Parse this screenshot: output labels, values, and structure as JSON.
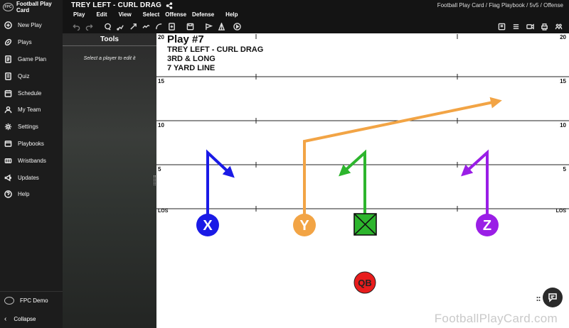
{
  "app": {
    "brand": "Football Play Card",
    "play_title": "TREY LEFT - CURL DRAG"
  },
  "breadcrumbs": "Football Play Card  /  Flag Playbook  /  5v5  /  Offense",
  "menu": [
    "Play",
    "Edit",
    "View",
    "Select",
    "Offense",
    "Defense",
    "Help"
  ],
  "sidebar": {
    "items": [
      {
        "label": "New Play",
        "icon": "plus-circle-icon"
      },
      {
        "label": "Plays",
        "icon": "football-icon"
      },
      {
        "label": "Game Plan",
        "icon": "document-icon"
      },
      {
        "label": "Quiz",
        "icon": "quiz-icon"
      },
      {
        "label": "Schedule",
        "icon": "calendar-icon"
      },
      {
        "label": "My Team",
        "icon": "user-icon"
      },
      {
        "label": "Settings",
        "icon": "gear-icon"
      },
      {
        "label": "Playbooks",
        "icon": "book-icon"
      },
      {
        "label": "Wristbands",
        "icon": "wristband-icon"
      },
      {
        "label": "Updates",
        "icon": "megaphone-icon"
      },
      {
        "label": "Help",
        "icon": "help-icon"
      }
    ],
    "user": "FPC Demo",
    "collapse": "Collapse"
  },
  "tools": {
    "title": "Tools",
    "hint": "Select a player to edit it"
  },
  "play": {
    "number": "Play #7",
    "name": "TREY LEFT - CURL DRAG",
    "situation": "3RD & LONG",
    "field_position": "7 YARD LINE"
  },
  "field": {
    "yard_labels": {
      "y20": "20",
      "y15": "15",
      "y10": "10",
      "y5": "5",
      "los": "LOS"
    },
    "players": [
      {
        "label": "X",
        "color": "#1a1ae6"
      },
      {
        "label": "Y",
        "color": "#f2a445"
      },
      {
        "label": "",
        "color": "#2db52d"
      },
      {
        "label": "Z",
        "color": "#9a1ee6"
      },
      {
        "label": "QB",
        "color": "#e81c1c"
      }
    ],
    "watermark": "FootballPlayCard.com"
  }
}
